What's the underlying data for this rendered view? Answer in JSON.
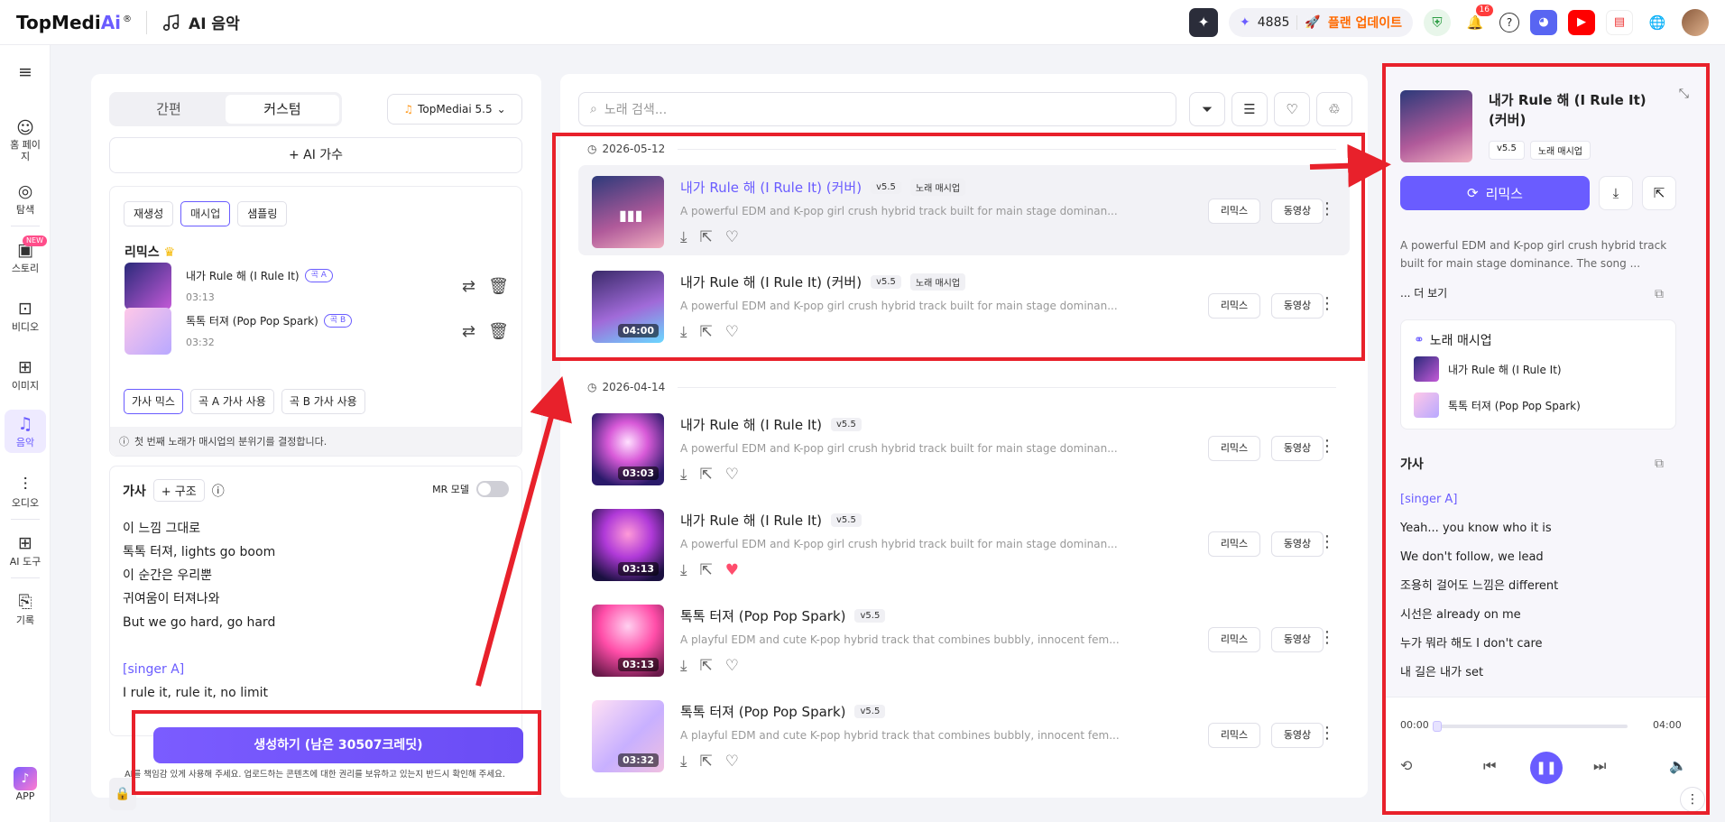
{
  "app": {
    "logo_text": "TopMedi",
    "logo_ai": "Ai",
    "logo_reg": "®",
    "section": "AI 음악"
  },
  "header": {
    "credits": "4885",
    "upgrade": "플랜 업데이트",
    "notif_count": "16"
  },
  "nav": {
    "items": [
      {
        "label": "홈 페이지",
        "icon": "home-icon"
      },
      {
        "label": "탐색",
        "icon": "compass-icon"
      },
      {
        "label": "스토리",
        "icon": "story-icon",
        "badge": "NEW"
      },
      {
        "label": "비디오",
        "icon": "video-icon"
      },
      {
        "label": "이미지",
        "icon": "image-icon"
      },
      {
        "label": "음악",
        "icon": "music-icon"
      },
      {
        "label": "오디오",
        "icon": "audio-icon"
      },
      {
        "label": "AI 도구",
        "icon": "tools-icon"
      },
      {
        "label": "기록",
        "icon": "history-icon"
      },
      {
        "label": "APP",
        "icon": "app-icon"
      }
    ]
  },
  "left": {
    "mode_simple": "간편",
    "mode_custom": "커스텀",
    "model": "TopMediai 5.5",
    "ai_singer": "+ AI 가수",
    "mix_tabs": [
      "재생성",
      "매시업",
      "샘플링"
    ],
    "remix_title": "리믹스",
    "songs": [
      {
        "name": "내가 Rule 해 (I Rule It)",
        "tag": "곡 A",
        "duration": "03:13"
      },
      {
        "name": "톡톡 터져 (Pop Pop Spark)",
        "tag": "곡 B",
        "duration": "03:32"
      }
    ],
    "lyric_buttons": [
      "가사 믹스",
      "곡 A 가사 사용",
      "곡 B 가사 사용"
    ],
    "info": "첫 번째 노래가 매시업의 분위기를 결정합니다.",
    "lyrics_title": "가사",
    "structure": "+ 구조",
    "mr_mode": "MR 모델",
    "lyrics": [
      "이 느낌 그대로",
      "톡톡 터져, lights go boom",
      "이 순간은 우리뿐",
      "귀여움이 터져나와",
      "But we go hard, go hard",
      "",
      "[singer A]",
      "I rule it, rule it, no limit"
    ],
    "generate": "생성하기 (남은 30507크레딧)",
    "disclaimer": "AI를 책임감 있게 사용해 주세요. 업로드하는 콘텐츠에 대한 권리를 보유하고 있는지 반드시 확인해 주세요."
  },
  "middle": {
    "search_placeholder": "노래 검색...",
    "groups": [
      {
        "date": "2026-05-12"
      },
      {
        "date": "2026-04-14"
      }
    ],
    "tracks": [
      {
        "title": "내가 Rule 해 (I Rule It) (커버)",
        "version": "v5.5",
        "tag2": "노래 매시업",
        "desc": "A powerful EDM and K-pop girl crush hybrid track built for main stage dominan...",
        "duration": "",
        "liked": false
      },
      {
        "title": "내가 Rule 해 (I Rule It) (커버)",
        "version": "v5.5",
        "tag2": "노래 매시업",
        "desc": "A powerful EDM and K-pop girl crush hybrid track built for main stage dominan...",
        "duration": "04:00",
        "liked": false
      },
      {
        "title": "내가 Rule 해 (I Rule It)",
        "version": "v5.5",
        "tag2": "",
        "desc": "A powerful EDM and K-pop girl crush hybrid track built for main stage dominan...",
        "duration": "03:03",
        "liked": false
      },
      {
        "title": "내가 Rule 해 (I Rule It)",
        "version": "v5.5",
        "tag2": "",
        "desc": "A powerful EDM and K-pop girl crush hybrid track built for main stage dominan...",
        "duration": "03:13",
        "liked": true
      },
      {
        "title": "톡톡 터져 (Pop Pop Spark)",
        "version": "v5.5",
        "tag2": "",
        "desc": "A playful EDM and cute K-pop hybrid track that combines bubbly, innocent fem...",
        "duration": "03:13",
        "liked": false
      },
      {
        "title": "톡톡 터져 (Pop Pop Spark)",
        "version": "v5.5",
        "tag2": "",
        "desc": "A playful EDM and cute K-pop hybrid track that combines bubbly, innocent fem...",
        "duration": "03:32",
        "liked": false
      }
    ],
    "remix_label": "리믹스",
    "video_label": "동영상"
  },
  "right": {
    "title": "내가 Rule 해 (I Rule It) (커버)",
    "version": "v5.5",
    "tag": "노래 매시업",
    "remix": "리믹스",
    "desc": "A powerful EDM and K-pop girl crush hybrid track built for main stage dominance. The song ...",
    "more": "... 더 보기",
    "mashup_title": "노래 매시업",
    "mashup_items": [
      "내가 Rule 해 (I Rule It)",
      "톡톡 터져 (Pop Pop Spark)"
    ],
    "lyrics_title": "가사",
    "lyrics": [
      "[singer A]",
      "Yeah... you know who it is",
      "We don't follow, we lead",
      "조용히 걸어도 느낌은 different",
      "시선은 already on me",
      "누가 뭐라 해도 I don't care",
      "내 길은 내가 set"
    ],
    "time_current": "00:00",
    "time_total": "04:00"
  },
  "colors": {
    "accent": "#6a5cff",
    "annotation": "#e8212b"
  }
}
